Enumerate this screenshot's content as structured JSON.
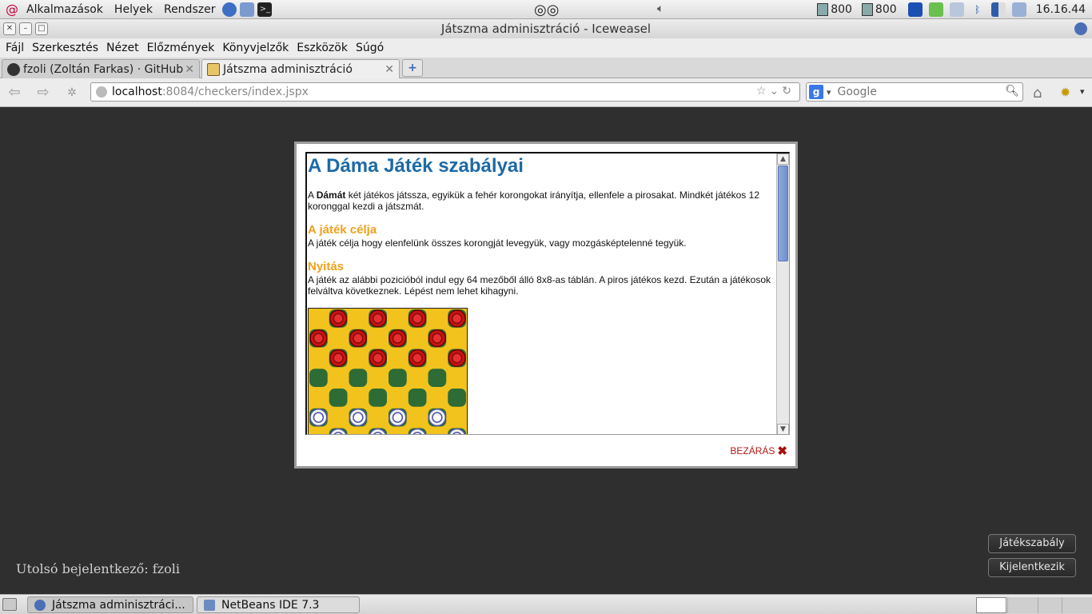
{
  "top_panel": {
    "menus": [
      "Alkalmazások",
      "Helyek",
      "Rendszer"
    ],
    "cpu1": "800",
    "cpu2": "800",
    "clock": "16.16.44"
  },
  "window": {
    "title": "Játszma adminisztráció - Iceweasel"
  },
  "menubar": {
    "items": [
      "Fájl",
      "Szerkesztés",
      "Nézet",
      "Előzmények",
      "Könyvjelzők",
      "Eszközök",
      "Súgó"
    ]
  },
  "tabs": [
    {
      "label": "fzoli (Zoltán Farkas) · GitHub"
    },
    {
      "label": "Játszma adminisztráció"
    }
  ],
  "navbar": {
    "url_host": "localhost",
    "url_rest": ":8084/checkers/index.jspx",
    "search_placeholder": "Google"
  },
  "dialog": {
    "title": "A Dáma Játék szabályai",
    "intro_pre": "A ",
    "intro_bold": "Dámát",
    "intro_post": " két játékos játssza, egyikük a fehér korongokat irányítja, ellenfele a pirosakat. Mindkét játékos 12 koronggal kezdi a játszmát.",
    "goal_heading": "A játék célja",
    "goal_text": "A játék célja hogy elenfelünk összes korongját levegyük, vagy mozgásképtelenné tegyük.",
    "open_heading": "Nyitás",
    "open_text": "A játék az alábbi pozicióból indul egy 64 mezőből álló 8x8-as táblán. A piros játékos kezd. Ezután a játékosok felváltva következnek. Lépést nem lehet kihagyni.",
    "close_label": "BEZÁRÁS"
  },
  "page": {
    "last_login": "Utolsó bejelentkező: fzoli",
    "rules_button": "Játékszabály",
    "logout_button": "Kijelentkezik"
  },
  "taskbar": {
    "items": [
      "Játszma adminisztráci...",
      "NetBeans IDE 7.3"
    ]
  },
  "colors": {
    "heading_blue": "#1d6aa6",
    "heading_orange": "#f0a01c",
    "close_red": "#b01818",
    "board_yellow": "#f2c21d",
    "board_green": "#2e6b35"
  }
}
